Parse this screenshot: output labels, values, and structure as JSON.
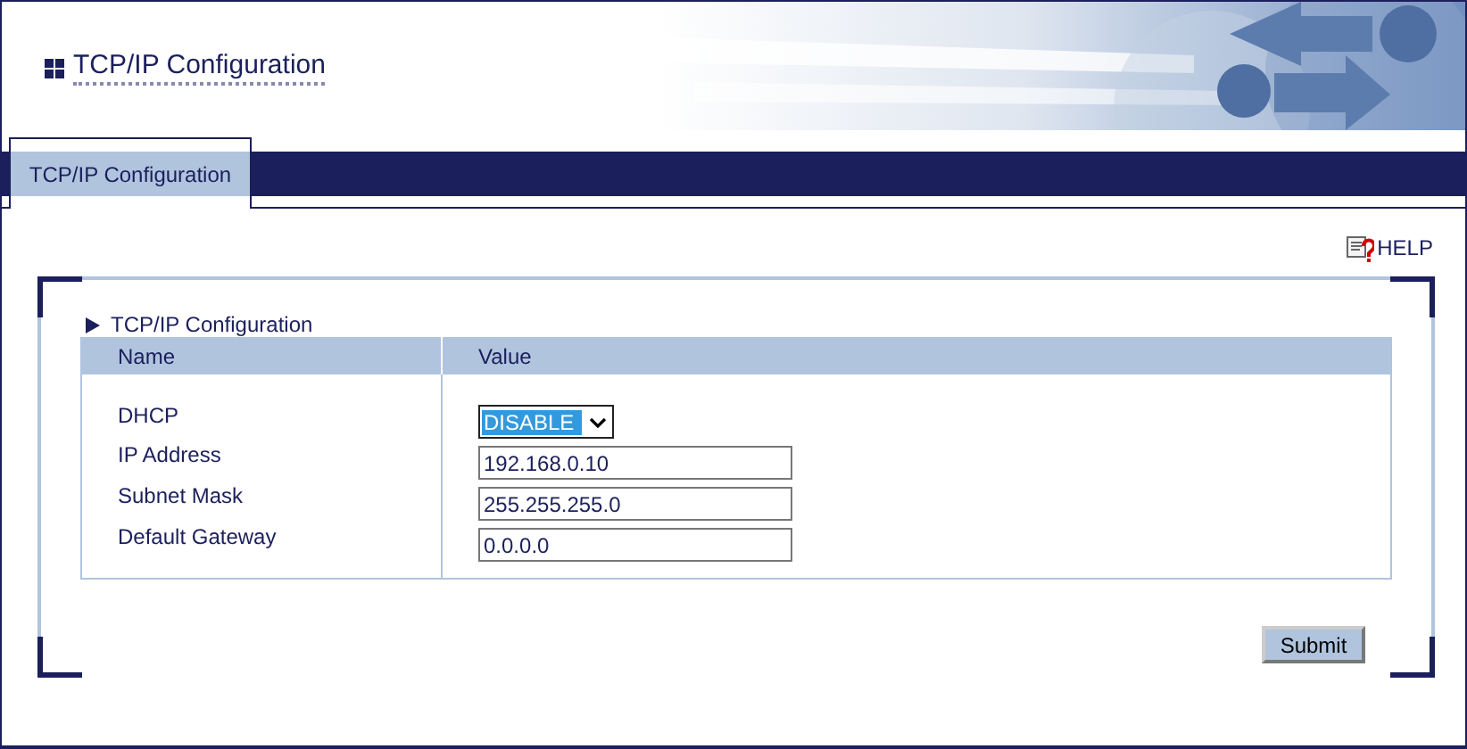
{
  "page_title": "TCP/IP Configuration",
  "tabs": [
    {
      "label": "TCP/IP Configuration",
      "selected": true
    }
  ],
  "help": "HELP",
  "section": {
    "title": "TCP/IP Configuration",
    "columns": [
      "Name",
      "Value"
    ],
    "rows": [
      {
        "name": "DHCP",
        "kind": "select",
        "value": "DISABLE"
      },
      {
        "name": "IP Address",
        "kind": "text",
        "value": "192.168.0.10"
      },
      {
        "name": "Subnet Mask",
        "kind": "text",
        "value": "255.255.255.0"
      },
      {
        "name": "Default Gateway",
        "kind": "text",
        "value": "0.0.0.0"
      }
    ]
  },
  "buttons": [
    "Submit"
  ]
}
